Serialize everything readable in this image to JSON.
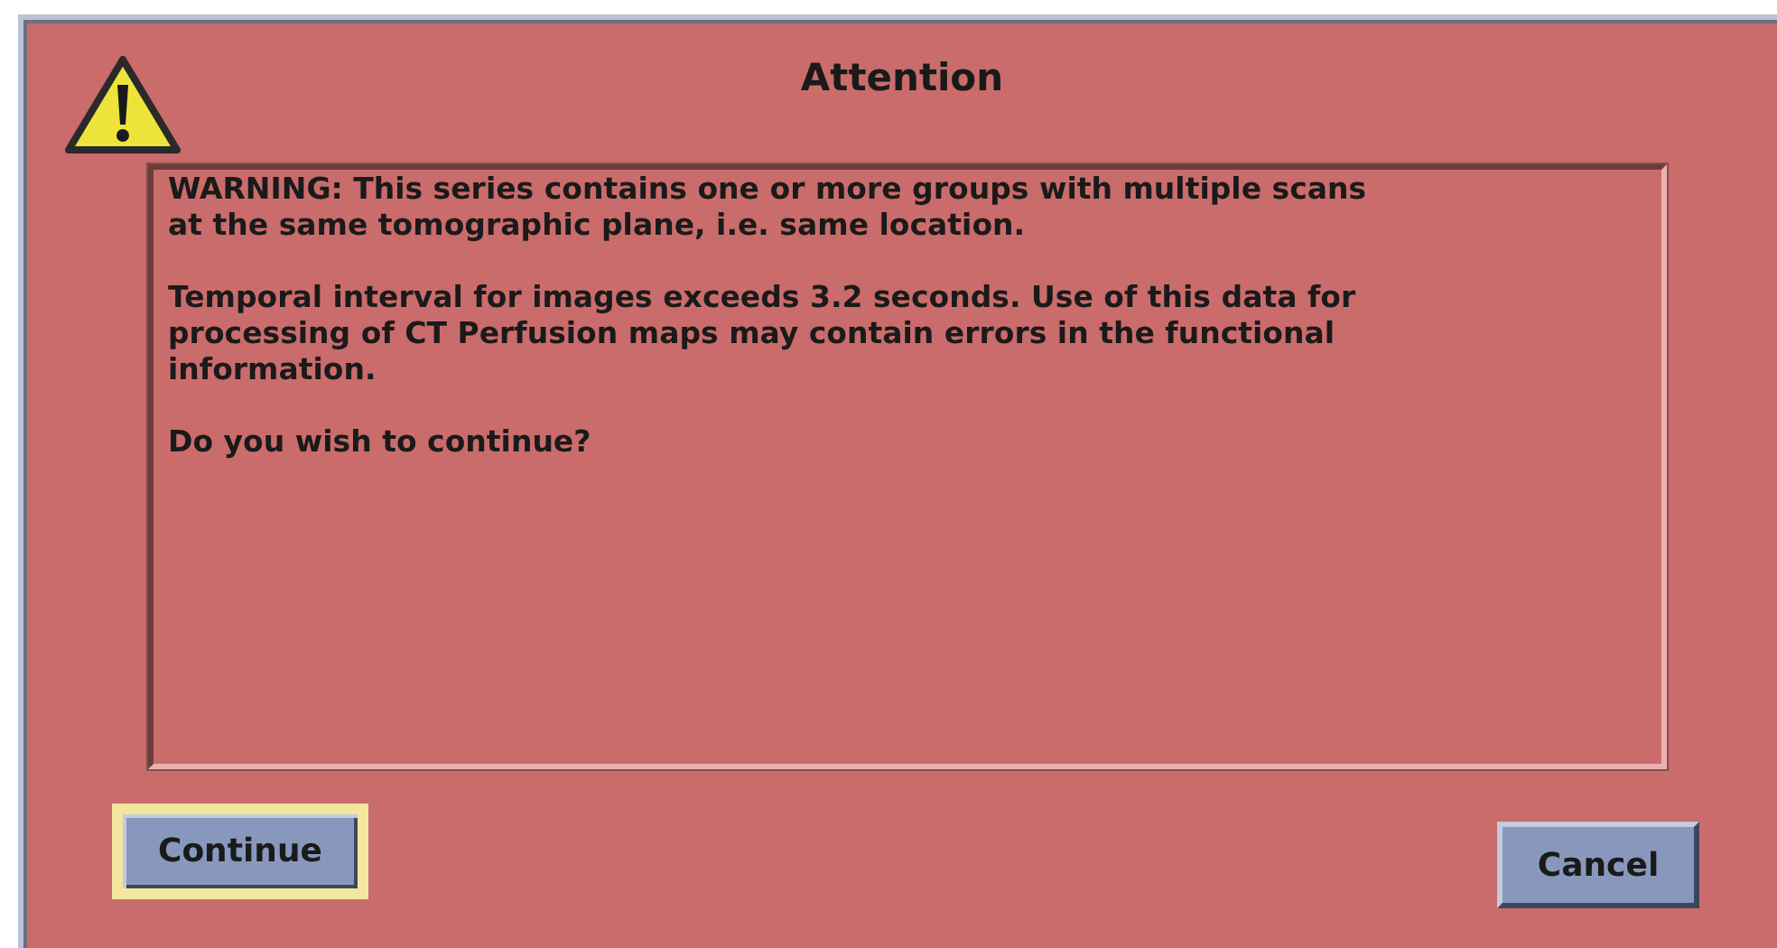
{
  "dialog": {
    "title": "Attention",
    "message": [
      [
        "WARNING: This series contains one or more groups with multiple scans",
        "at the same tomographic plane, i.e. same location."
      ],
      [
        "Temporal interval for images exceeds 3.2 seconds. Use of this data for",
        "processing of CT Perfusion maps may contain errors in the functional",
        "information."
      ],
      [
        "Do you wish to continue?"
      ]
    ],
    "buttons": [
      {
        "label": "Continue",
        "focused": true
      },
      {
        "label": "Cancel",
        "focused": false
      }
    ]
  }
}
